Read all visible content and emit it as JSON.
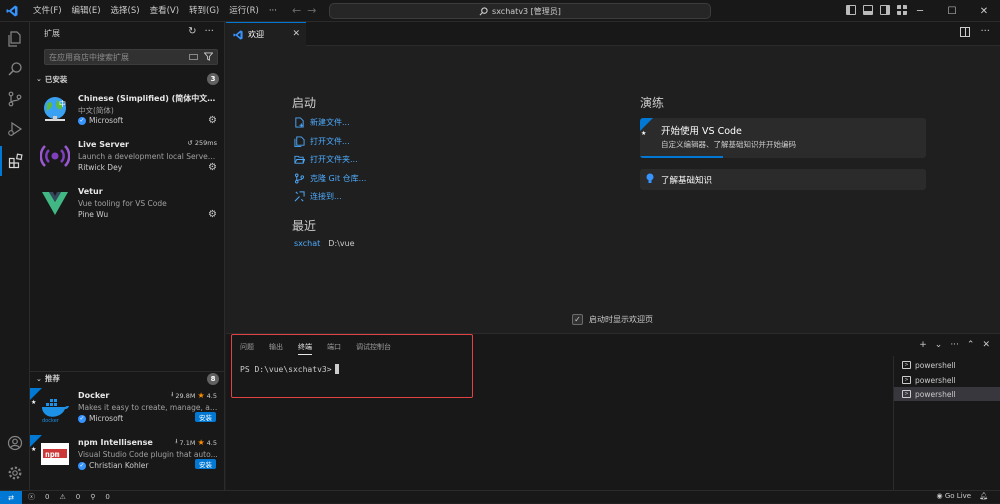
{
  "titlebar": {
    "menu": [
      "文件(F)",
      "编辑(E)",
      "选择(S)",
      "查看(V)",
      "转到(G)",
      "运行(R)",
      "···"
    ],
    "command_center": "sxchatv3 [管理员]"
  },
  "sidebar": {
    "title": "扩展",
    "search_placeholder": "在应用商店中搜索扩展",
    "installed": {
      "label": "已安装",
      "count": "3",
      "items": [
        {
          "name": "Chinese (Simplified) (简体中文) L...",
          "desc": "中文(简体)",
          "publisher": "Microsoft",
          "verified": true
        },
        {
          "name": "Live Server",
          "desc": "Launch a development local Server ...",
          "publisher": "Ritwick Dey",
          "time": "259ms"
        },
        {
          "name": "Vetur",
          "desc": "Vue tooling for VS Code",
          "publisher": "Pine Wu"
        }
      ]
    },
    "recommended": {
      "label": "推荐",
      "count": "8",
      "items": [
        {
          "name": "Docker",
          "desc": "Makes it easy to create, manage, an...",
          "publisher": "Microsoft",
          "downloads": "29.8M",
          "rating": "4.5",
          "install": "安装"
        },
        {
          "name": "npm Intellisense",
          "desc": "Visual Studio Code plugin that auto...",
          "publisher": "Christian Kohler",
          "downloads": "7.1M",
          "rating": "4.5",
          "install": "安装"
        }
      ]
    }
  },
  "tab": {
    "label": "欢迎"
  },
  "welcome": {
    "start_heading": "启动",
    "start_links": [
      "新建文件...",
      "打开文件...",
      "打开文件夹...",
      "克隆 Git 仓库...",
      "连接到..."
    ],
    "recent_heading": "最近",
    "recent": [
      {
        "name": "sxchat",
        "path": "D:\\vue"
      }
    ],
    "walkthrough_heading": "演练",
    "walkthrough_primary_title": "开始使用 VS Code",
    "walkthrough_primary_subtitle": "自定义编辑器、了解基础知识并开始编码",
    "walkthrough_progress": 0.29,
    "walkthrough_secondary": "了解基础知识",
    "show_on_startup": "启动时显示欢迎页"
  },
  "panel": {
    "tabs": [
      "问题",
      "输出",
      "终端",
      "端口",
      "调试控制台"
    ],
    "active_tab": "终端",
    "terminal_prompt": "PS D:\\vue\\sxchatv3>",
    "terminals": [
      "powershell",
      "powershell",
      "powershell"
    ]
  },
  "statusbar": {
    "errors": "0",
    "warnings": "0",
    "ports": "0",
    "golive": "Go Live"
  },
  "colors": {
    "accent": "#0078d4",
    "link": "#4daafc",
    "highlight_box": "#e04343",
    "rating_star": "#ff8e00"
  }
}
